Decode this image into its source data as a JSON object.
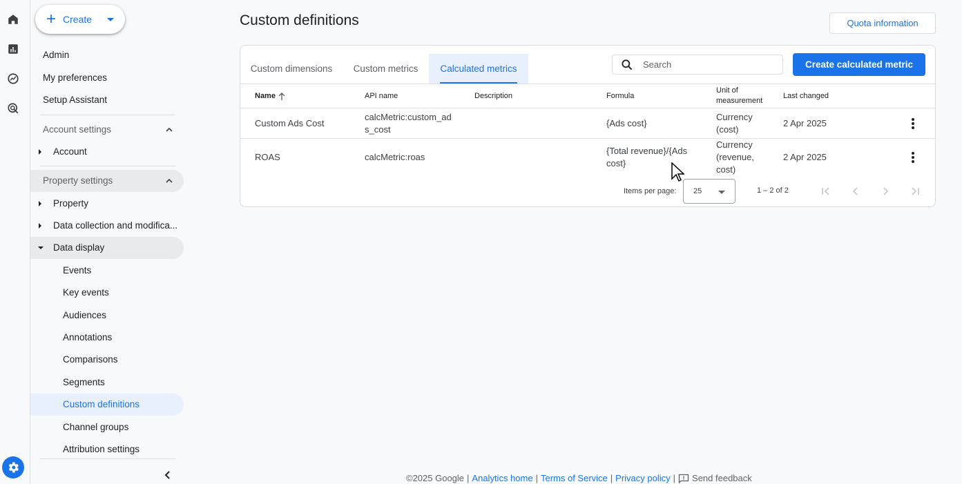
{
  "rail": {
    "icons": [
      "home-icon",
      "reports-icon",
      "explore-icon",
      "advertising-icon"
    ],
    "settings_icon": "gear-icon"
  },
  "sidebar": {
    "create_label": "Create",
    "admin": "Admin",
    "my_preferences": "My preferences",
    "setup_assistant": "Setup Assistant",
    "account_settings": "Account settings",
    "account": "Account",
    "property_settings": "Property settings",
    "property": "Property",
    "data_collection": "Data collection and modifica...",
    "data_display": "Data display",
    "sub_items": [
      "Events",
      "Key events",
      "Audiences",
      "Annotations",
      "Comparisons",
      "Segments",
      "Custom definitions",
      "Channel groups",
      "Attribution settings"
    ],
    "active_item": "Custom definitions"
  },
  "main": {
    "title": "Custom definitions",
    "quota_button": "Quota information",
    "tabs": [
      {
        "label": "Custom dimensions",
        "active": false
      },
      {
        "label": "Custom metrics",
        "active": false
      },
      {
        "label": "Calculated metrics",
        "active": true
      }
    ],
    "search_placeholder": "Search",
    "create_button": "Create calculated metric",
    "columns": {
      "name": "Name",
      "api_name": "API name",
      "description": "Description",
      "formula": "Formula",
      "unit_line1": "Unit of",
      "unit_line2": "measurement",
      "last_changed": "Last changed"
    },
    "rows": [
      {
        "name": "Custom Ads Cost",
        "api_line1": "calcMetric:custom_ad",
        "api_line2": "s_cost",
        "description": "",
        "formula_line1": "{Ads cost}",
        "formula_line2": "",
        "unit_line1": "Currency",
        "unit_line2": "(cost)",
        "unit_line3": "",
        "last_changed": "2 Apr 2025"
      },
      {
        "name": "ROAS",
        "api_line1": "calcMetric:roas",
        "api_line2": "",
        "description": "",
        "formula_line1": "{Total revenue}/{Ads",
        "formula_line2": "cost}",
        "unit_line1": "Currency",
        "unit_line2": "(revenue,",
        "unit_line3": "cost)",
        "last_changed": "2 Apr 2025"
      }
    ],
    "pager": {
      "items_per_page_label": "Items per page:",
      "page_size": "25",
      "range": "1 – 2 of 2"
    }
  },
  "footer": {
    "copyright": "©2025 Google",
    "analytics_home": "Analytics home",
    "terms": "Terms of Service",
    "privacy": "Privacy policy",
    "feedback": "Send feedback"
  },
  "colors": {
    "accent": "#1a73e8",
    "active_bg": "#e8f0fe",
    "section_bg": "#e8eaed"
  }
}
